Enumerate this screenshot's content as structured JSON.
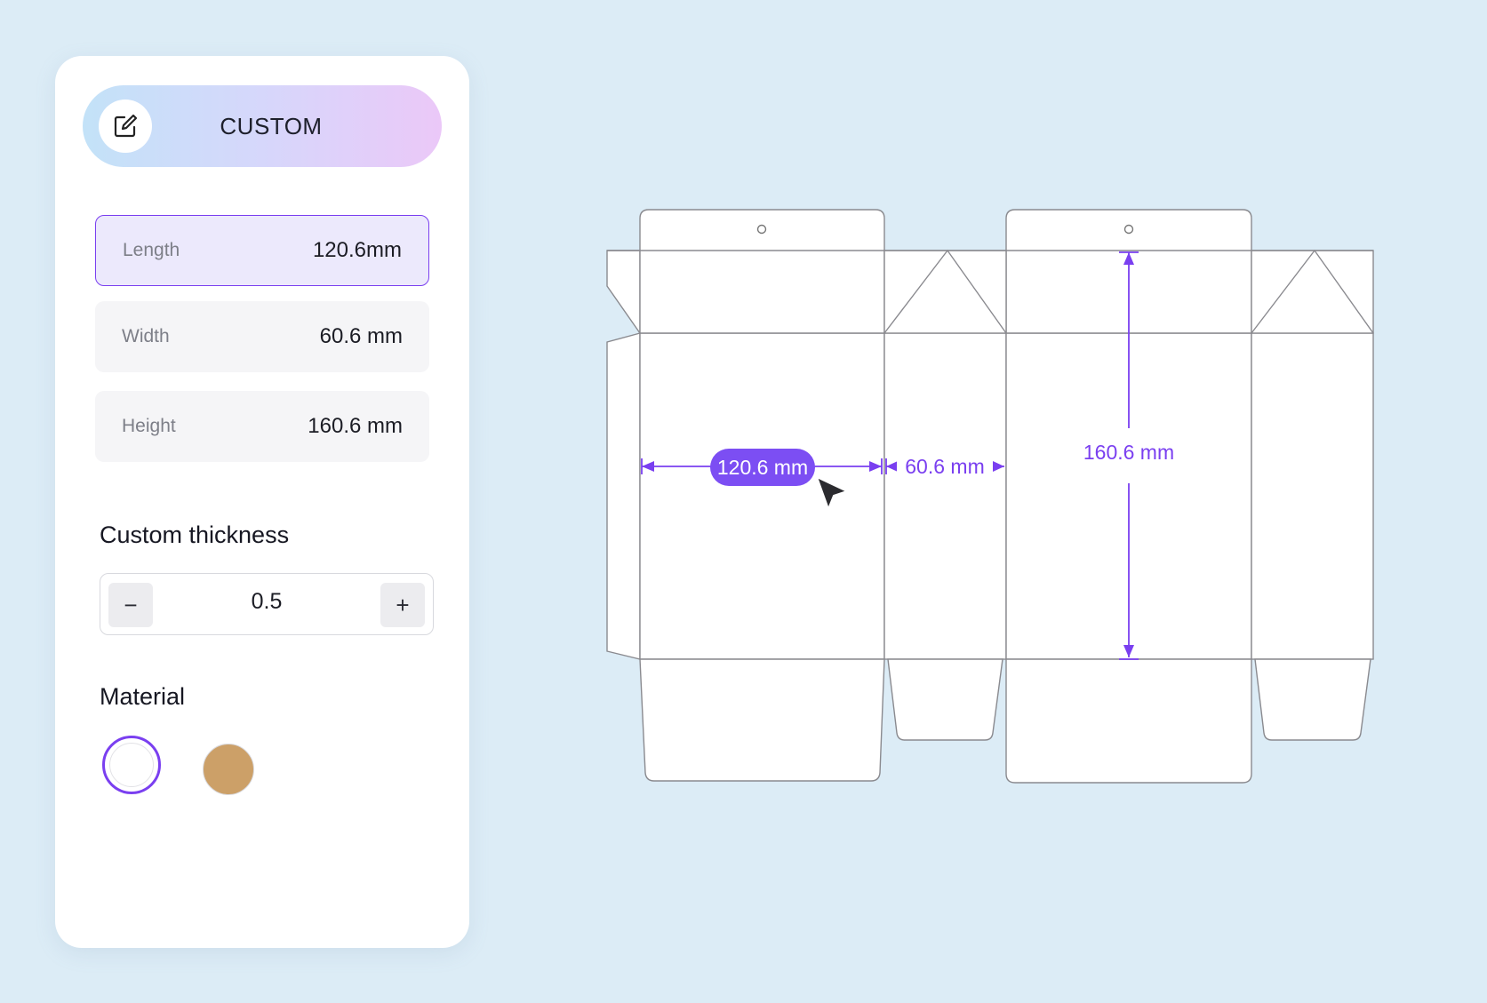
{
  "header": {
    "label": "CUSTOM",
    "icon": "edit-icon"
  },
  "dimensions": [
    {
      "label": "Length",
      "value": "120.6mm",
      "active": true
    },
    {
      "label": "Width",
      "value": "60.6 mm",
      "active": false
    },
    {
      "label": "Height",
      "value": "160.6 mm",
      "active": false
    }
  ],
  "thickness": {
    "title": "Custom thickness",
    "value": "0.5",
    "minus_label": "−",
    "plus_label": "+"
  },
  "material": {
    "title": "Material",
    "options": [
      {
        "name": "white",
        "color": "#ffffff",
        "selected": true
      },
      {
        "name": "kraft",
        "color": "#cca068",
        "selected": false
      }
    ]
  },
  "dieline": {
    "length_label": "120.6 mm",
    "width_label": "60.6 mm",
    "height_label": "160.6 mm"
  },
  "colors": {
    "accent": "#7a3ff0",
    "label_bg": "#7c4ef3",
    "background": "#dcecf6"
  }
}
